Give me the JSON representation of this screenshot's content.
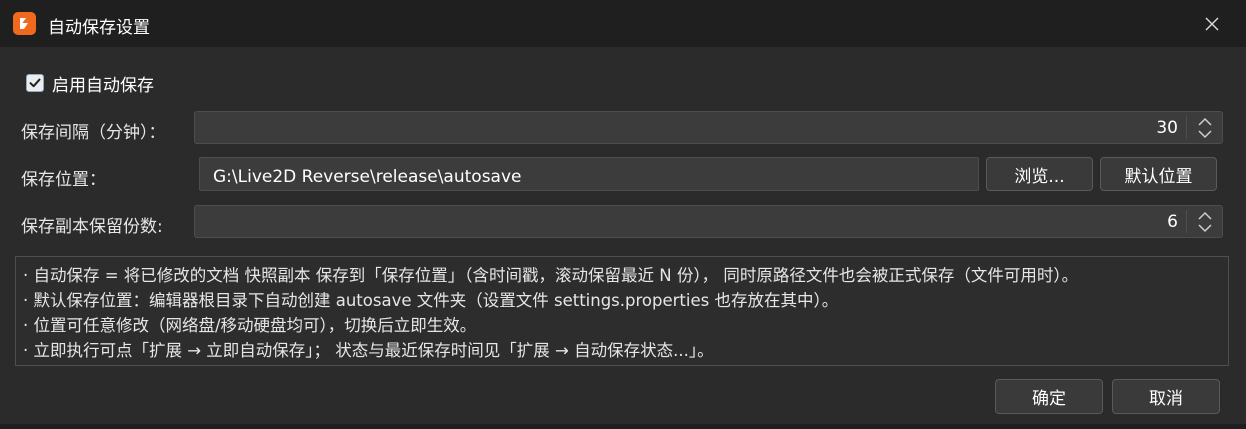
{
  "window": {
    "title": "自动保存设置",
    "accent_color": "#ef6a1f"
  },
  "options": {
    "enable_autosave": {
      "label": "启用自动保存",
      "checked": true
    }
  },
  "interval": {
    "label": "保存间隔（分钟）：",
    "value": "30"
  },
  "location": {
    "label": "保存位置：",
    "value": "G:\\Live2D Reverse\\release\\autosave",
    "browse_label": "浏览...",
    "default_label": "默认位置"
  },
  "copies": {
    "label": "保存副本保留份数:",
    "value": "6"
  },
  "info": {
    "lines": [
      "· 自动保存 = 将已修改的文档 快照副本 保存到「保存位置」（含时间戳，滚动保留最近 N 份）， 同时原路径文件也会被正式保存（文件可用时）。",
      "· 默认保存位置：编辑器根目录下自动创建 autosave 文件夹（设置文件 settings.properties 也存放在其中）。",
      "· 位置可任意修改（网络盘/移动硬盘均可），切换后立即生效。",
      "· 立即执行可点「扩展 → 立即自动保存」； 状态与最近保存时间见「扩展 → 自动保存状态...」。"
    ]
  },
  "footer": {
    "ok_label": "确定",
    "cancel_label": "取消"
  },
  "icons": {
    "app": "live2d-logo-icon",
    "close": "close-icon",
    "check": "checkmark-icon",
    "spin": "spin-arrows-icon"
  }
}
